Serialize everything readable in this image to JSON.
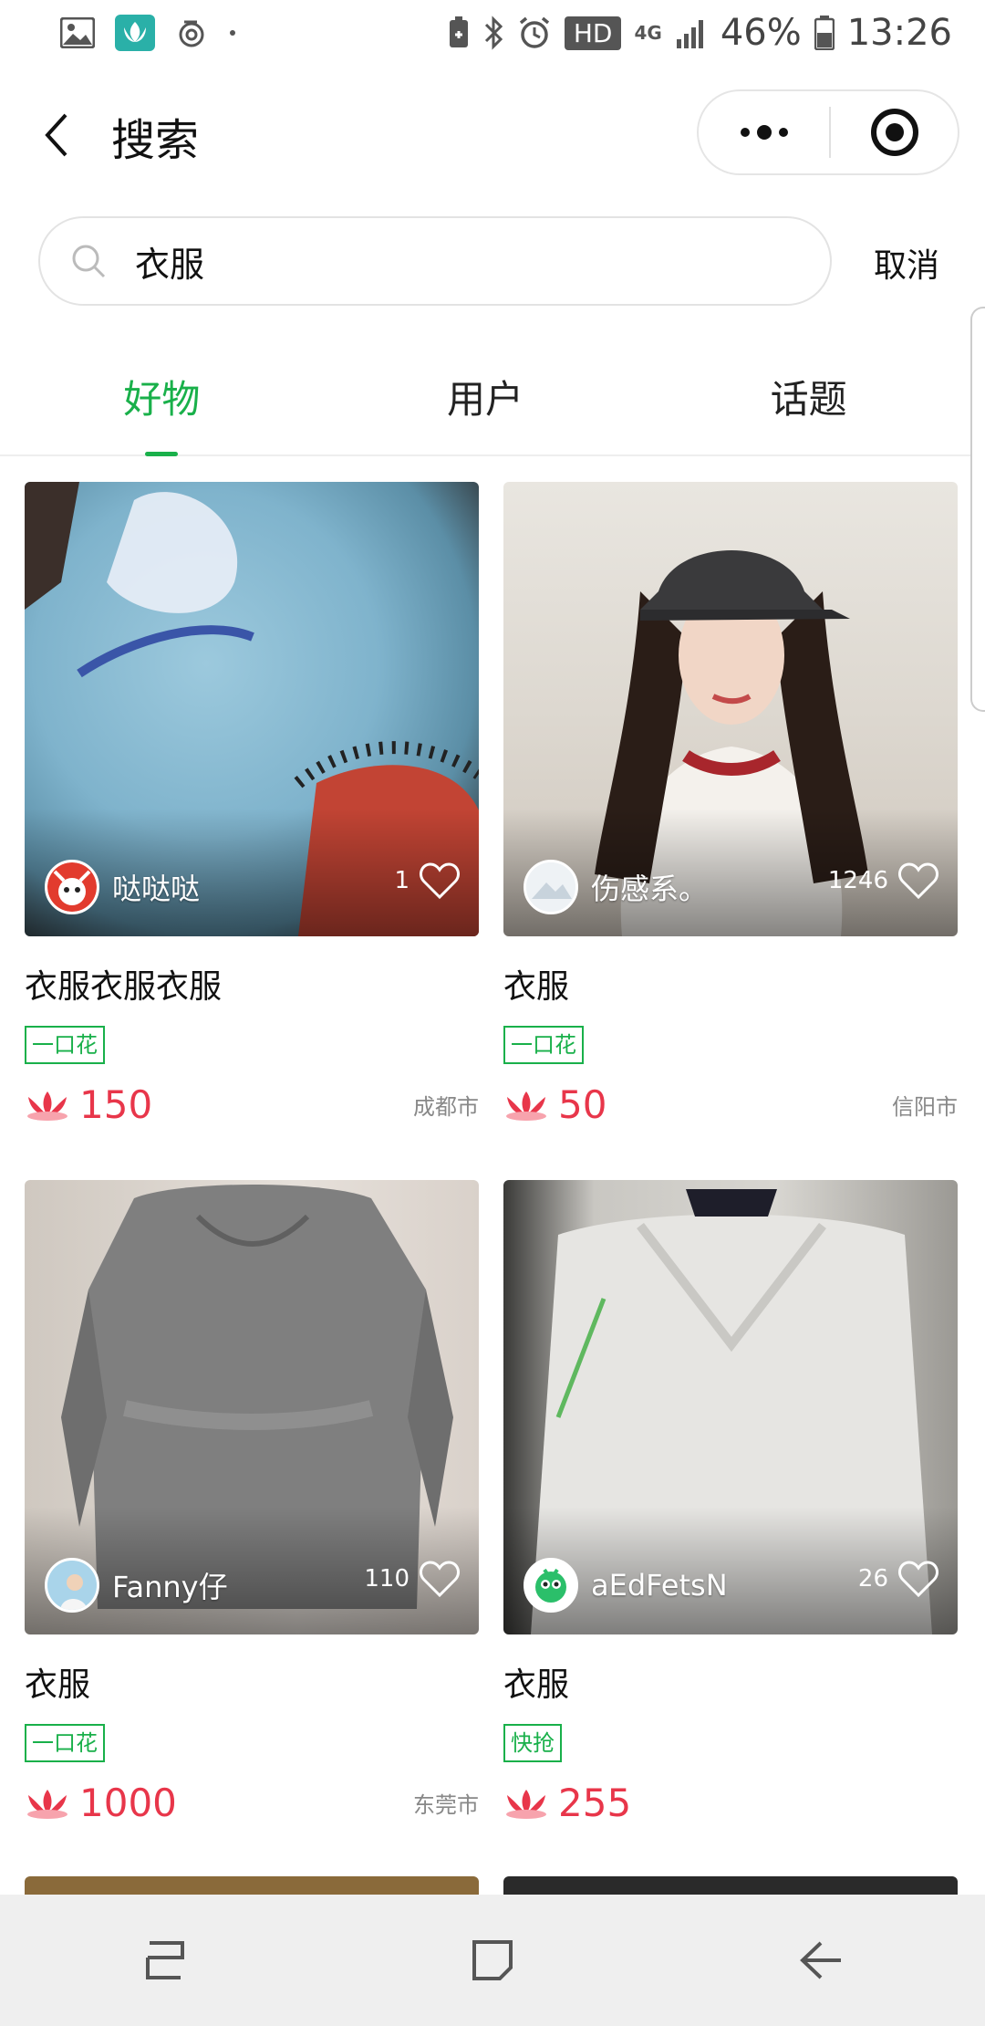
{
  "status_bar": {
    "network": "4G",
    "battery": "46%",
    "time": "13:26",
    "hd": "HD"
  },
  "header": {
    "title": "搜索"
  },
  "search": {
    "query": "衣服",
    "cancel_label": "取消"
  },
  "tabs": [
    {
      "label": "好物",
      "active": true
    },
    {
      "label": "用户",
      "active": false
    },
    {
      "label": "话题",
      "active": false
    }
  ],
  "colors": {
    "accent": "#19b04a",
    "price": "#e8364a"
  },
  "items": [
    {
      "user": "哒哒哒",
      "likes": "1",
      "title": "衣服衣服衣服",
      "tag": "一口花",
      "price": "150",
      "city": "成都市"
    },
    {
      "user": "伤感系。",
      "likes": "1246",
      "title": "衣服",
      "tag": "一口花",
      "price": "50",
      "city": "信阳市"
    },
    {
      "user": "Fanny仔",
      "likes": "110",
      "title": "衣服",
      "tag": "一口花",
      "price": "1000",
      "city": "东莞市"
    },
    {
      "user": "aEdFetsN",
      "likes": "26",
      "title": "衣服",
      "tag": "快抢",
      "price": "255",
      "city": ""
    }
  ]
}
